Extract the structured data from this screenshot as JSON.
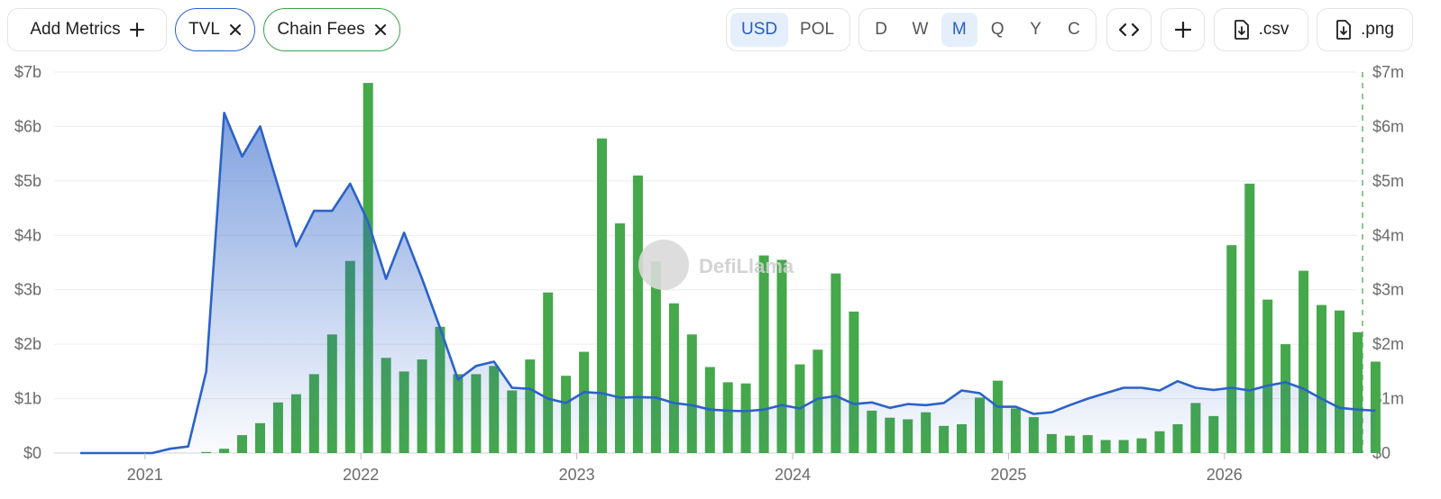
{
  "toolbar": {
    "add_metrics": "Add Metrics",
    "pill_tvl": "TVL",
    "pill_fees": "Chain Fees",
    "currency": [
      "USD",
      "POL"
    ],
    "currency_active": 0,
    "periods": [
      "D",
      "W",
      "M",
      "Q",
      "Y",
      "C"
    ],
    "period_active": 2,
    "csv": ".csv",
    "png": ".png"
  },
  "watermark": "DefiLlama",
  "colors": {
    "tvl": "#2b62c9",
    "fees": "#45a84b",
    "accent": "#2560c4"
  },
  "chart_data": {
    "type": "bar+line",
    "y_left": {
      "ticks": [
        "$0",
        "$1b",
        "$2b",
        "$3b",
        "$4b",
        "$5b",
        "$6b",
        "$7b"
      ],
      "range": [
        0,
        7
      ]
    },
    "y_right": {
      "ticks": [
        "$0",
        "$1m",
        "$2m",
        "$3m",
        "$4m",
        "$5m",
        "$6m",
        "$7m"
      ],
      "range": [
        0,
        7
      ]
    },
    "x_ticks": [
      "2021",
      "2022",
      "2023",
      "2024",
      "2025",
      "2026"
    ],
    "x_tick_months": [
      4,
      16,
      28,
      40,
      52,
      64
    ],
    "series": [
      {
        "name": "TVL",
        "kind": "line",
        "unit": "b",
        "values": [
          0.0,
          0.0,
          0.0,
          0.0,
          0.0,
          0.08,
          0.12,
          1.5,
          6.25,
          5.45,
          6.0,
          4.9,
          3.8,
          4.45,
          4.45,
          4.95,
          4.25,
          3.2,
          4.05,
          3.2,
          2.3,
          1.35,
          1.6,
          1.68,
          1.2,
          1.18,
          1.0,
          0.92,
          1.12,
          1.1,
          1.02,
          1.03,
          1.02,
          0.92,
          0.88,
          0.8,
          0.78,
          0.77,
          0.8,
          0.88,
          0.82,
          1.0,
          1.05,
          0.9,
          0.93,
          0.83,
          0.9,
          0.88,
          0.92,
          1.15,
          1.1,
          0.85,
          0.85,
          0.72,
          0.75,
          0.88,
          1.0,
          1.1,
          1.2,
          1.2,
          1.15,
          1.32,
          1.2,
          1.16,
          1.2,
          1.15,
          1.24,
          1.3,
          1.18,
          1.0,
          0.83,
          0.8,
          0.78
        ]
      },
      {
        "name": "Chain Fees",
        "kind": "bar",
        "unit": "m",
        "values": [
          0,
          0,
          0,
          0,
          0,
          0,
          0,
          0.02,
          0.08,
          0.33,
          0.55,
          0.93,
          1.08,
          1.45,
          2.18,
          3.53,
          6.8,
          1.75,
          1.5,
          1.72,
          2.32,
          1.45,
          1.45,
          1.6,
          1.15,
          1.72,
          2.95,
          1.42,
          1.86,
          5.78,
          4.22,
          5.1,
          3.52,
          2.75,
          2.18,
          1.58,
          1.3,
          1.28,
          3.63,
          3.55,
          1.63,
          1.9,
          3.3,
          2.6,
          0.78,
          0.65,
          0.62,
          0.75,
          0.5,
          0.53,
          1.02,
          1.33,
          0.82,
          0.66,
          0.35,
          0.32,
          0.33,
          0.24,
          0.24,
          0.27,
          0.4,
          0.53,
          0.92,
          0.68,
          3.82,
          4.95,
          2.82,
          2.0,
          3.35,
          2.72,
          2.62,
          2.22,
          1.68
        ]
      }
    ]
  }
}
